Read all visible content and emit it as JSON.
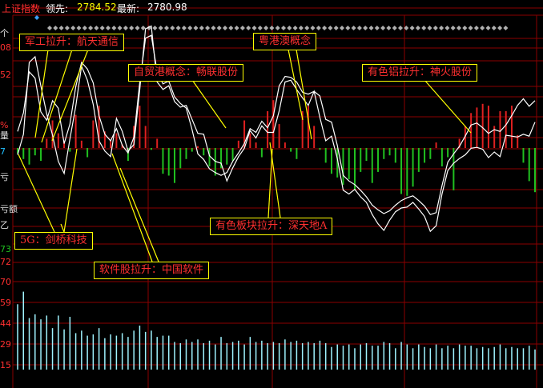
{
  "header": {
    "index_name": "上证指数",
    "leading_label": "领先:",
    "leading_value": "2784.52",
    "latest_label": "最新:",
    "latest_value": "2780.98"
  },
  "colors": {
    "background": "#000000",
    "grid": "#8b0000",
    "index_line": "#ffffff",
    "leading_line": "#ffffff",
    "up_bar": "#e02020",
    "down_bar": "#20c020",
    "volume": "#9ff3ff",
    "annotation_border": "#ffff00",
    "annotation_text": "#ff3030",
    "marker_row": "#b0b0b0",
    "marker_active": "#3aa0ff"
  },
  "left_axis_fragments": {
    "price_panel": [
      "个",
      "08",
      "52",
      "%",
      "量",
      "7",
      "亏",
      "亏额",
      "乙"
    ],
    "volume_panel": [
      "73",
      "72",
      "70",
      "59",
      "44",
      "29",
      "15"
    ]
  },
  "annotations": [
    {
      "id": "military",
      "text": "军工拉升：航天通信"
    },
    {
      "id": "ftz",
      "text": "自贸港概念：畅联股份"
    },
    {
      "id": "gba",
      "text": "粤港澳概念"
    },
    {
      "id": "aluminum",
      "text": "有色铝拉升：神火股份"
    },
    {
      "id": "nonferrous",
      "text": "有色板块拉升：深天地A"
    },
    {
      "id": "5g",
      "text": "5G：剑桥科技"
    },
    {
      "id": "software",
      "text": "软件股拉升：中国软件"
    }
  ],
  "chart_data": {
    "type": "line",
    "title": "上证指数",
    "x_points": 90,
    "y_domain": [
      2768,
      2792
    ],
    "series": [
      {
        "name": "最新",
        "values": [
          2777.3,
          2779.5,
          2787.2,
          2787.8,
          2784.7,
          2781.7,
          2779.4,
          2776.6,
          2775.3,
          2779.0,
          2782.5,
          2786.8,
          2785.3,
          2782.7,
          2778.8,
          2777.7,
          2777.1,
          2781.2,
          2779.8,
          2777.7,
          2778.4,
          2784.2,
          2790.8,
          2791.1,
          2785.1,
          2784.3,
          2784.7,
          2783.0,
          2782.4,
          2782.6,
          2781.1,
          2779.6,
          2779.5,
          2777.2,
          2776.6,
          2776.4,
          2774.5,
          2775.9,
          2777.1,
          2778.0,
          2779.9,
          2779.1,
          2780.4,
          2779.7,
          2779.7,
          2782.0,
          2785.1,
          2785.3,
          2784.3,
          2783.4,
          2782.6,
          2784.1,
          2781.3,
          2778.8,
          2779.3,
          2776.9,
          2773.5,
          2773.1,
          2773.6,
          2772.8,
          2772.2,
          2770.9,
          2769.9,
          2769.2,
          2770.3,
          2771.2,
          2771.6,
          2771.7,
          2772.2,
          2771.5,
          2770.7,
          2769.1,
          2769.7,
          2773.1,
          2775.6,
          2776.4,
          2776.9,
          2777.3,
          2778.0,
          2778.1,
          2777.9,
          2777.0,
          2777.6,
          2777.1,
          2779.4,
          2779.3,
          2779.2,
          2779.5,
          2779.3,
          2780.8
        ]
      },
      {
        "name": "领先",
        "values": [
          2779.8,
          2781.8,
          2786.2,
          2785.5,
          2781.9,
          2781.0,
          2783.1,
          2782.3,
          2778.5,
          2780.6,
          2784.6,
          2787.2,
          2786.5,
          2785.0,
          2781.5,
          2779.5,
          2778.8,
          2780.1,
          2778.3,
          2777.5,
          2779.2,
          2785.0,
          2789.8,
          2790.1,
          2786.2,
          2784.9,
          2785.2,
          2783.5,
          2782.8,
          2782.3,
          2780.0,
          2777.4,
          2776.8,
          2775.8,
          2775.4,
          2775.1,
          2775.4,
          2776.6,
          2777.5,
          2778.5,
          2780.1,
          2779.7,
          2780.9,
          2780.2,
          2781.5,
          2784.7,
          2785.7,
          2785.6,
          2785.1,
          2784.0,
          2783.8,
          2784.1,
          2783.6,
          2781.1,
          2780.8,
          2778.3,
          2775.1,
          2774.5,
          2774.1,
          2773.5,
          2772.8,
          2771.9,
          2771.4,
          2771.0,
          2771.3,
          2771.9,
          2772.4,
          2772.7,
          2772.9,
          2772.4,
          2771.8,
          2770.9,
          2771.1,
          2774.0,
          2776.5,
          2777.4,
          2778.2,
          2779.3,
          2780.5,
          2780.7,
          2780.2,
          2779.6,
          2780.0,
          2779.8,
          2780.5,
          2781.5,
          2782.6,
          2783.3,
          2782.5,
          2783.1
        ]
      }
    ],
    "strength_bars": [
      -3,
      -6,
      -9,
      -4,
      -7,
      5,
      15,
      8,
      4,
      -2,
      18,
      4,
      -5,
      15,
      23,
      9,
      4,
      8,
      2,
      -7,
      12,
      23,
      12,
      -1,
      5,
      -14,
      -15,
      -19,
      -11,
      -6,
      -2,
      1,
      -4,
      -10,
      -15,
      -11,
      -9,
      -7,
      4,
      15,
      8,
      3,
      -5,
      20,
      26,
      13,
      3,
      -2,
      -6,
      20,
      23,
      12,
      -1,
      -8,
      -14,
      -16,
      -20,
      -17,
      -23,
      -13,
      -7,
      -19,
      -13,
      -6,
      -4,
      -8,
      -25,
      -26,
      -21,
      -13,
      -8,
      -6,
      3,
      -10,
      -5,
      -23,
      5,
      12,
      19,
      22,
      24,
      23,
      12,
      20,
      20,
      23,
      7,
      -8,
      -18,
      -24
    ],
    "volume_values": [
      52,
      62,
      41,
      44,
      40,
      43,
      33,
      43,
      32,
      42,
      29,
      31,
      27,
      28,
      33,
      25,
      28,
      27,
      29,
      26,
      31,
      35,
      30,
      31,
      26,
      27,
      27,
      22,
      21,
      24,
      22,
      24,
      21,
      23,
      20,
      26,
      21,
      22,
      23,
      20,
      26,
      22,
      23,
      21,
      22,
      21,
      24,
      22,
      23,
      21,
      22,
      21,
      23,
      21,
      18,
      20,
      19,
      20,
      17,
      20,
      21,
      19,
      19,
      22,
      21,
      17,
      22,
      20,
      17,
      20,
      18,
      17,
      20,
      17,
      19,
      17,
      20,
      19,
      19,
      17,
      18,
      17,
      18,
      20,
      17,
      18,
      17,
      17,
      19,
      16
    ],
    "volume_domain": [
      0,
      70
    ],
    "xlabel": "",
    "ylabel": ""
  }
}
